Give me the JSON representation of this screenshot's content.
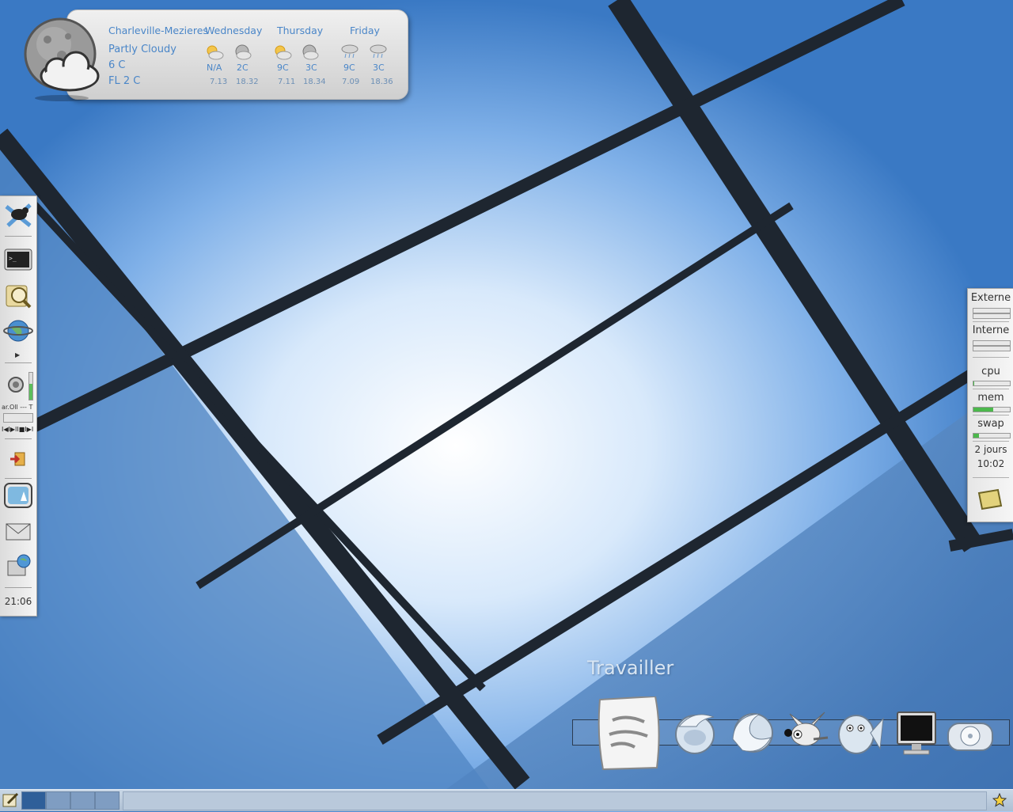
{
  "weather": {
    "city": "Charleville-Mezieres",
    "condition": "Partly Cloudy",
    "temp": "6 C",
    "feels_like": "FL 2 C",
    "days": [
      {
        "name": "Wednesday",
        "icons": [
          "sun-cloud-icon",
          "moon-cloud-icon"
        ],
        "temps": [
          "N/A",
          "2C"
        ],
        "times": [
          "7.13",
          "18.32"
        ]
      },
      {
        "name": "Thursday",
        "icons": [
          "sun-cloud-icon",
          "moon-cloud-icon"
        ],
        "temps": [
          "9C",
          "3C"
        ],
        "times": [
          "7.11",
          "18.34"
        ]
      },
      {
        "name": "Friday",
        "icons": [
          "rain-cloud-icon",
          "rain-cloud-icon"
        ],
        "temps": [
          "9C",
          "3C"
        ],
        "times": [
          "7.09",
          "18.36"
        ]
      }
    ]
  },
  "left_panel": {
    "items": [
      "xfce-mouse-icon",
      "terminal-icon",
      "file-search-icon",
      "globe-icon",
      "volume-icon",
      "music-player-icon",
      "logout-icon",
      "photo-viewer-icon",
      "mail-icon",
      "network-icon"
    ],
    "player_track": "ar.Oll --- T",
    "player_controls": "I◀I▶II■I▶I",
    "clock": "21:06"
  },
  "right_panel": {
    "externe": "Externe",
    "interne": "Interne",
    "cpu": "cpu",
    "mem": "mem",
    "swap": "swap",
    "uptime_days": "2 jours",
    "uptime_time": "10:02",
    "mem_level": 0.55,
    "swap_level": 0.15,
    "cpu_level": 0.02
  },
  "dock": {
    "title": "Travailler",
    "icons": [
      "text-editor-icon",
      "thunderbird-icon",
      "firefox-icon",
      "gimp-icon",
      "gaim-icon",
      "monitor-icon",
      "cd-player-icon"
    ]
  },
  "taskbar": {
    "desktops": 4,
    "active_desktop": 1
  },
  "colors": {
    "panel_bg": "#e8e8e8",
    "weather_text": "#4a86c8",
    "taskbar_bg": "#b9c9db",
    "mem_bar": "#4cb84c"
  }
}
